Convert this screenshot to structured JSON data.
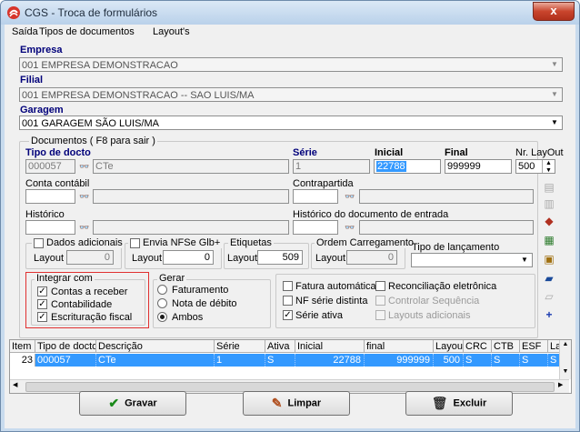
{
  "window": {
    "title": "CGS - Troca de formulários",
    "close": "x"
  },
  "menu": [
    "Saída",
    "Tipos de documentos",
    "Layout's"
  ],
  "empresa": {
    "label": "Empresa",
    "value": "001 EMPRESA DEMONSTRACAO"
  },
  "filial": {
    "label": "Filial",
    "value": "001 EMPRESA DEMONSTRACAO -- SAO LUIS/MA"
  },
  "garagem": {
    "label": "Garagem",
    "value": "001 GARAGEM SÃO LUIS/MA"
  },
  "documentos": {
    "title": "Documentos ( F8 para sair )",
    "tipo_label": "Tipo de docto",
    "tipo_code": "000057",
    "tipo_desc": "CTe",
    "serie_label": "Série",
    "serie_value": "1",
    "inicial_label": "Inicial",
    "inicial_value": "22788",
    "final_label": "Final",
    "final_value": "999999",
    "nrlayout_label": "Nr. LayOut",
    "nrlayout_value": "500",
    "conta_contabil_label": "Conta contábil",
    "contrapartida_label": "Contrapartida",
    "historico_label": "Histórico",
    "historico_entrada_label": "Histórico do documento de entrada",
    "dados_adicionais": {
      "label": "Dados adicionais",
      "layout_label": "Layout",
      "layout_value": "0"
    },
    "envia_nfse": {
      "label": "Envia NFSe Glb+",
      "layout_label": "Layout",
      "layout_value": "0"
    },
    "etiquetas": {
      "label": "Etiquetas",
      "layout_label": "Layout",
      "layout_value": "509"
    },
    "ordem_carregamento": {
      "label": "Ordem Carregamento",
      "layout_label": "Layout",
      "layout_value": "0"
    },
    "tipo_lancamento_label": "Tipo de lançamento"
  },
  "integrar": {
    "title": "Integrar com",
    "items": [
      "Contas a receber",
      "Contabilidade",
      "Escrituração fiscal"
    ]
  },
  "gerar": {
    "title": "Gerar",
    "options": [
      "Faturamento",
      "Nota de débito",
      "Ambos"
    ],
    "selected": "Ambos"
  },
  "flags": {
    "fatura_automatica": "Fatura automática",
    "nf_serie_distinta": "NF série distinta",
    "serie_ativa": "Série ativa",
    "reconciliacao": "Reconciliação eletrônica",
    "controlar_sequencia": "Controlar Sequência",
    "layouts_adicionais": "Layouts adicionais"
  },
  "table": {
    "headers": [
      "Item",
      "Tipo de docto",
      "Descrição",
      "Série",
      "Ativa",
      "Inicial",
      "final",
      "Layout",
      "CRC",
      "CTB",
      "ESF",
      "La"
    ],
    "rows": [
      [
        "23",
        "000057",
        "CTe",
        "1",
        "S",
        "22788",
        "999999",
        "500",
        "S",
        "S",
        "S",
        "S"
      ]
    ]
  },
  "buttons": {
    "gravar": "Gravar",
    "limpar": "Limpar",
    "excluir": "Excluir"
  },
  "colors": {
    "selection": "#3399ff",
    "label_blue": "#00007a",
    "highlight_box": "#e03030"
  }
}
